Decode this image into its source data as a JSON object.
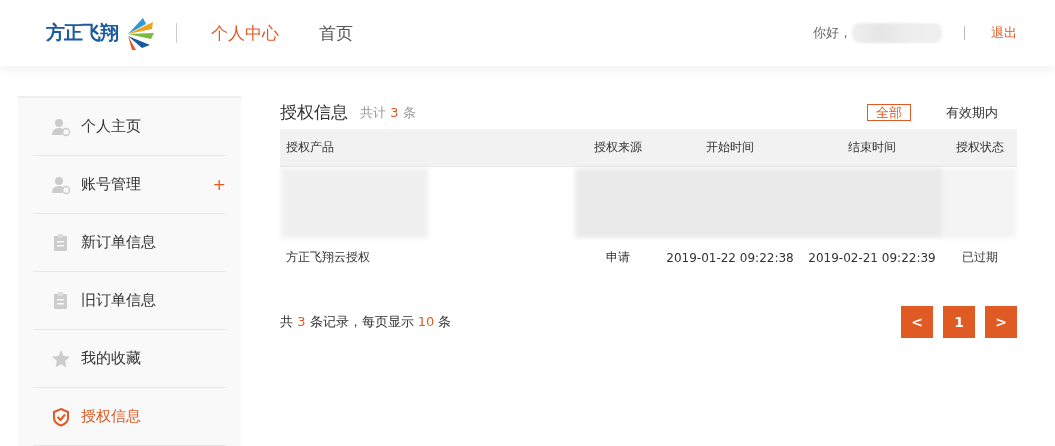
{
  "header": {
    "logo_text": "方正飞翔",
    "nav": [
      {
        "label": "个人中心",
        "selected": true
      },
      {
        "label": "首页",
        "selected": false
      }
    ],
    "greeting": "你好，",
    "user_redacted": true,
    "logout": "退出"
  },
  "sidebar": {
    "items": [
      {
        "label": "个人主页",
        "selected": false
      },
      {
        "label": "账号管理",
        "selected": false,
        "expand_symbol": "+"
      },
      {
        "label": "新订单信息",
        "selected": false
      },
      {
        "label": "旧订单信息",
        "selected": false
      },
      {
        "label": "我的收藏",
        "selected": false
      },
      {
        "label": "授权信息",
        "selected": true
      }
    ]
  },
  "section": {
    "title": "授权信息",
    "count_prefix": "共计",
    "count": "3",
    "count_suffix": "条"
  },
  "filters": [
    {
      "label": "全部",
      "selected": true
    },
    {
      "label": "有效期内",
      "selected": false
    }
  ],
  "table": {
    "columns": [
      "授权产品",
      "授权来源",
      "开始时间",
      "结束时间",
      "授权状态"
    ],
    "rows": [
      {
        "kind": "redacted"
      },
      {
        "kind": "data",
        "cells": [
          "方正飞翔云授权",
          "申请",
          "2019-01-22 09:22:38",
          "2019-02-21 09:22:39",
          "已过期"
        ]
      }
    ]
  },
  "pagination": {
    "parts": [
      "共",
      "3",
      "条记录，每页显示",
      "10",
      "条"
    ],
    "prev": "<",
    "pages": [
      {
        "label": "1",
        "selected": true
      }
    ],
    "next": ">"
  }
}
